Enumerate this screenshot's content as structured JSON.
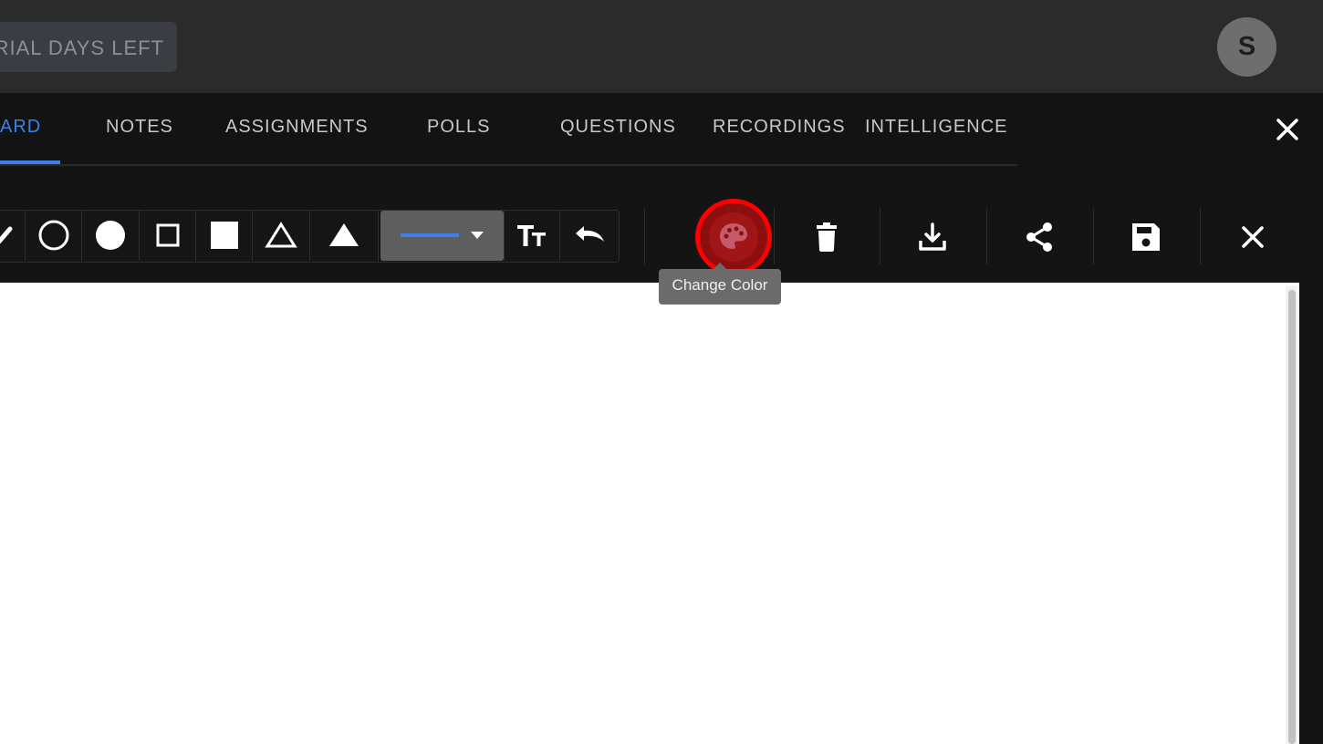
{
  "header": {
    "trial_label": "TRIAL DAYS LEFT",
    "avatar_initial": "S"
  },
  "tabs": [
    {
      "label": "ARD",
      "active": true
    },
    {
      "label": "NOTES",
      "active": false
    },
    {
      "label": "ASSIGNMENTS",
      "active": false
    },
    {
      "label": "POLLS",
      "active": false
    },
    {
      "label": "QUESTIONS",
      "active": false
    },
    {
      "label": "RECORDINGS",
      "active": false
    },
    {
      "label": "INTELLIGENCE",
      "active": false
    }
  ],
  "toolbar": {
    "tools": [
      "pencil-icon",
      "circle-outline-icon",
      "circle-filled-icon",
      "square-outline-icon",
      "square-filled-icon",
      "triangle-outline-icon",
      "triangle-filled-icon",
      "line-style-dropdown",
      "text-size-icon",
      "undo-icon"
    ],
    "actions": [
      "palette-icon",
      "trash-icon",
      "download-icon",
      "share-icon",
      "save-icon",
      "close-icon"
    ],
    "tooltip": "Change Color"
  },
  "colors": {
    "accent": "#3c80e8",
    "highlight": "#ff0000",
    "line_color": "#3c80e8"
  }
}
